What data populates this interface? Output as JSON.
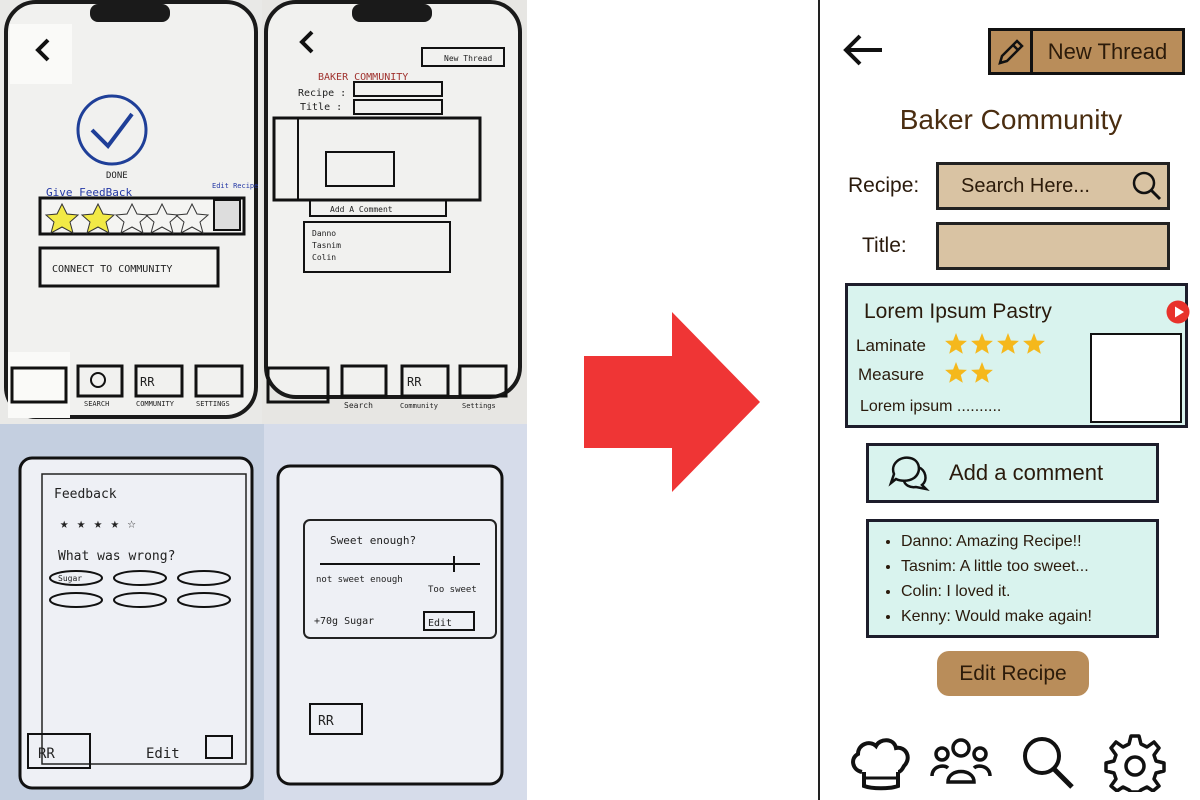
{
  "sketches": {
    "sketch1": {
      "done_label": "DONE",
      "feedback_label": "Give FeedBack",
      "edit_recipe_label": "Edit Recipe",
      "connect_button": "CONNECT TO COMMUNITY",
      "nav": [
        "SEARCH",
        "COMMUNITY",
        "SETTINGS"
      ]
    },
    "sketch2": {
      "new_thread": "New Thread",
      "title": "BAKER COMMUNITY",
      "recipe_label": "Recipe :",
      "title_label": "Title :",
      "add_comment": "Add A Comment",
      "commenters": [
        "Danno",
        "Tasnim",
        "Colin"
      ],
      "nav": [
        "Search",
        "Community",
        "Settings"
      ]
    },
    "sketch3": {
      "heading": "Feedback",
      "question": "What was wrong?",
      "option": "Sugar",
      "edit_label": "Edit"
    },
    "sketch4": {
      "question": "Sweet enough?",
      "left_label": "not sweet enough",
      "right_label": "Too sweet",
      "amount": "+70g Sugar",
      "edit_label": "Edit"
    }
  },
  "app": {
    "new_thread_label": "New Thread",
    "page_title": "Baker Community",
    "recipe_label": "Recipe:",
    "search_placeholder": "Search Here...",
    "title_label": "Title:",
    "card": {
      "title": "Lorem Ipsum Pastry",
      "ratings": [
        {
          "label": "Laminate",
          "stars": 4
        },
        {
          "label": "Measure",
          "stars": 2
        }
      ],
      "description": "Lorem ipsum .........."
    },
    "add_comment_label": "Add a comment",
    "comments": [
      "Danno: Amazing Recipe!!",
      "Tasnim: A little too sweet...",
      "Colin: I loved it.",
      "Kenny: Would make again!"
    ],
    "edit_recipe_label": "Edit Recipe",
    "nav_icons": [
      "chef-hat-icon",
      "community-icon",
      "search-icon",
      "settings-icon"
    ]
  },
  "colors": {
    "accent_brown": "#b98d5a",
    "field_tan": "#d9c3a3",
    "card_mint": "#d9f3ee",
    "star_gold": "#f5b81c",
    "arrow_red": "#ef3535",
    "title_brown": "#4a2d10"
  }
}
